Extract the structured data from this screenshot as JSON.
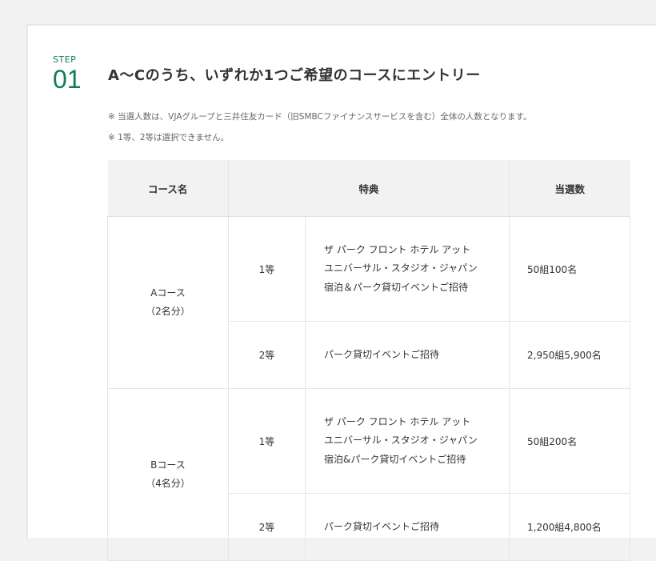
{
  "step": {
    "label": "STEP",
    "number": "01"
  },
  "heading": "A〜Cのうち、いずれか1つご希望のコースにエントリー",
  "notes": [
    "※ 当選人数は、VJAグループと三井住友カード（旧SMBCファイナンスサービスを含む）全体の人数となります。",
    "※ 1等、2等は選択できません。"
  ],
  "table": {
    "headers": {
      "course": "コース名",
      "benefit": "特典",
      "winners": "当選数"
    },
    "courses": [
      {
        "name": "Aコース",
        "people": "（2名分）",
        "prizes": [
          {
            "rank": "1等",
            "lines": [
              "ザ パーク フロント ホテル アット",
              "ユニバーサル・スタジオ・ジャパン",
              "宿泊＆パーク貸切イベントご招待"
            ],
            "count": "50組100名"
          },
          {
            "rank": "2等",
            "lines": [
              "パーク貸切イベントご招待"
            ],
            "count": "2,950組5,900名"
          }
        ]
      },
      {
        "name": "Bコース",
        "people": "（4名分）",
        "prizes": [
          {
            "rank": "1等",
            "lines": [
              "ザ パーク フロント ホテル アット",
              "ユニバーサル・スタジオ・ジャパン",
              "宿泊&パーク貸切イベントご招待"
            ],
            "count": "50組200名"
          },
          {
            "rank": "2等",
            "lines": [
              "パーク貸切イベントご招待"
            ],
            "count": "1,200組4,800名"
          }
        ]
      }
    ]
  },
  "colors": {
    "accent": "#0e7a5f",
    "header_bg": "#f2f2f2",
    "border": "#e6e6e6"
  }
}
